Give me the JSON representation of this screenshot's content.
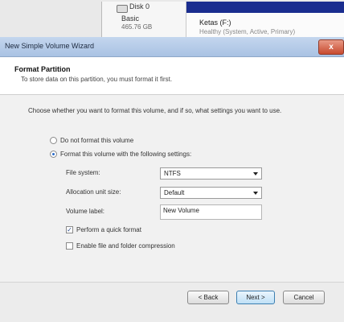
{
  "background": {
    "disk_name": "Disk 0",
    "disk_type": "Basic",
    "disk_size": "465.76 GB",
    "volume_label": "Ketas (F:)",
    "volume_detail": "Healthy (System, Active, Primary)"
  },
  "wizard": {
    "title": "New Simple Volume Wizard",
    "close_label": "x",
    "header": {
      "title": "Format Partition",
      "subtitle": "To store data on this partition, you must format it first."
    },
    "instructions": "Choose whether you want to format this volume, and if so, what settings you want to use.",
    "options": {
      "no_format": "Do not format this volume",
      "format": "Format this volume with the following settings:",
      "selected": "format"
    },
    "fields": {
      "file_system_label": "File system:",
      "file_system_value": "NTFS",
      "allocation_label": "Allocation unit size:",
      "allocation_value": "Default",
      "volume_label_label": "Volume label:",
      "volume_label_value": "New Volume"
    },
    "checkboxes": {
      "quick_format_label": "Perform a quick format",
      "quick_format_checked": true,
      "compression_label": "Enable file and folder compression",
      "compression_checked": false
    },
    "buttons": {
      "back": "< Back",
      "next": "Next >",
      "cancel": "Cancel"
    }
  }
}
